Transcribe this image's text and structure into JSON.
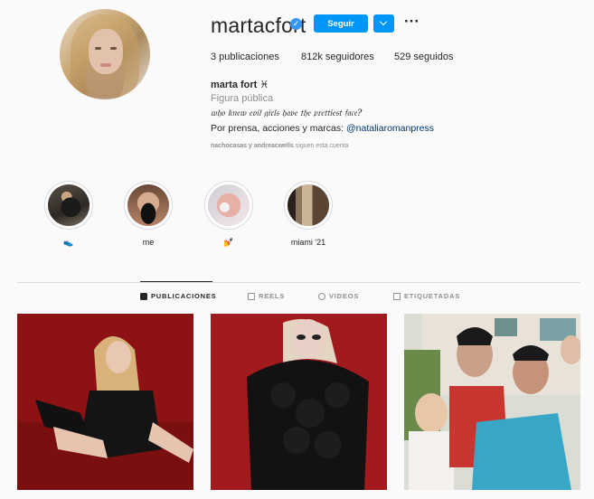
{
  "profile": {
    "username": "martacfort",
    "follow_label": "Seguir",
    "stats": {
      "posts": "3 publicaciones",
      "followers": "812k seguidores",
      "following": "529 seguidos"
    },
    "full_name": "marta fort ♓︎",
    "category": "Figura pública",
    "bio_line1": "𝔴𝔥𝔬 𝔨𝔫𝔢𝔴 𝔢𝔳𝔦𝔩 𝔤𝔦𝔯𝔩𝔰 𝔥𝔞𝔳𝔢 𝔱𝔥𝔢 𝔭𝔯𝔢𝔱𝔱𝔦𝔢𝔰𝔱 𝔣𝔞𝔠𝔢?",
    "bio_line2_prefix": "Por prensa, acciones y marcas: ",
    "bio_link": "@nataliaromanpress",
    "followed_by_names": "nachocasas y andreacwells",
    "followed_by_suffix": " siguen esta cuenta"
  },
  "highlights": [
    {
      "label": "👟"
    },
    {
      "label": "me"
    },
    {
      "label": "💅"
    },
    {
      "label": "miami '21"
    }
  ],
  "tabs": [
    {
      "label": "PUBLICACIONES",
      "active": true
    },
    {
      "label": "REELS",
      "active": false
    },
    {
      "label": "VIDEOS",
      "active": false
    },
    {
      "label": "ETIQUETADAS",
      "active": false
    }
  ],
  "colors": {
    "accent": "#0095f6",
    "link": "#00376b",
    "muted": "#8e8e8e",
    "border": "#dbdbdb"
  }
}
